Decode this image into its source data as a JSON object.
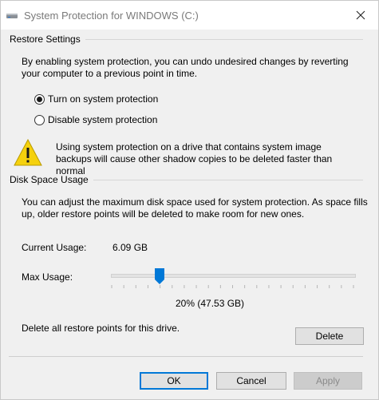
{
  "window": {
    "title": "System Protection for WINDOWS (C:)"
  },
  "restore_settings": {
    "group_title": "Restore Settings",
    "description": "By enabling system protection, you can undo undesired changes by reverting your computer to a previous point in time.",
    "options": [
      {
        "label": "Turn on system protection",
        "selected": true
      },
      {
        "label": "Disable system protection",
        "selected": false
      }
    ],
    "warning": "Using system protection on a drive that contains system image backups will cause other shadow copies to be deleted faster than normal"
  },
  "disk_space": {
    "group_title": "Disk Space Usage",
    "description": "You can adjust the maximum disk space used for system protection. As space fills up, older restore points will be deleted to make room for new ones.",
    "current_usage_label": "Current Usage:",
    "current_usage_value": "6.09 GB",
    "max_usage_label": "Max Usage:",
    "max_usage_percent": 20,
    "max_usage_text": "20% (47.53 GB)",
    "delete_text": "Delete all restore points for this drive.",
    "delete_button": "Delete"
  },
  "footer": {
    "ok": "OK",
    "cancel": "Cancel",
    "apply": "Apply",
    "apply_enabled": false
  },
  "colors": {
    "accent": "#0078d7",
    "warning": "#f5d10d"
  }
}
